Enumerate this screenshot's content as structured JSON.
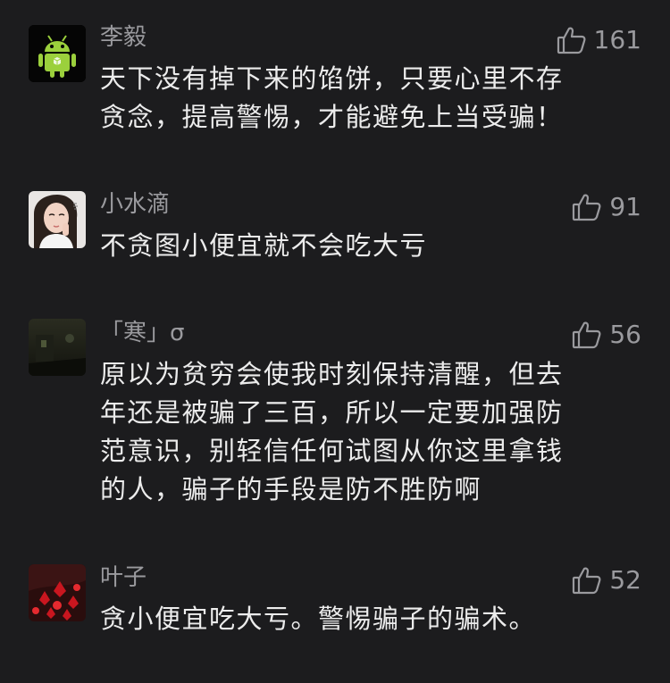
{
  "comments": [
    {
      "username": "李毅",
      "likes": "161",
      "lines": [
        "天下没有掉下来的馅饼，只要心里不存",
        "贪念，提高警惕，才能避免上当受骗！"
      ],
      "avatar": "android-robot-avatar"
    },
    {
      "username": "小水滴",
      "likes": "91",
      "lines": [
        "不贪图小便宜就不会吃大亏"
      ],
      "avatar": "girl-photo-avatar"
    },
    {
      "username": "「寒」σ",
      "likes": "56",
      "lines": [
        "原以为贫穷会使我时刻保持清醒，但去",
        "年还是被骗了三百，所以一定要加强防",
        "范意识，别轻信任何试图从你这里拿钱",
        "的人，骗子的手段是防不胜防啊"
      ],
      "avatar": "dark-scenery-avatar"
    },
    {
      "username": "叶子",
      "likes": "52",
      "lines": [
        "贪小便宜吃大亏。警惕骗子的骗术。"
      ],
      "avatar": "red-leaves-avatar"
    }
  ],
  "colors": {
    "background": "#1c1c1e",
    "username": "#9a9a9e",
    "body_text": "#ececec",
    "like": "#9a9a9e"
  },
  "icons": {
    "like": "thumbs-up-icon"
  }
}
